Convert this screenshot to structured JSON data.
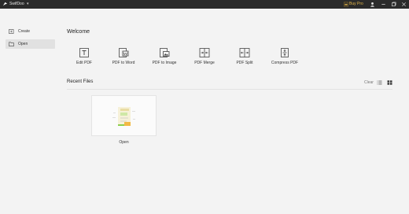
{
  "titlebar": {
    "app_name": "SwifDoo",
    "menu_arrow": "▾",
    "buy_pro": "Buy Pro",
    "icons": [
      "swifdoo-logo-icon",
      "crown-icon",
      "user-icon",
      "minimize-icon",
      "restore-icon",
      "close-icon"
    ]
  },
  "sidebar": {
    "items": [
      {
        "label": "Create",
        "icon": "create-icon",
        "active": false
      },
      {
        "label": "Open",
        "icon": "folder-icon",
        "active": true
      }
    ]
  },
  "main": {
    "welcome": "Welcome",
    "tools": [
      {
        "label": "Edit PDF",
        "icon": "edit-pdf-icon"
      },
      {
        "label": "PDF to Word",
        "icon": "pdf-to-word-icon"
      },
      {
        "label": "PDF to Image",
        "icon": "pdf-to-image-icon"
      },
      {
        "label": "PDF Merge",
        "icon": "pdf-merge-icon"
      },
      {
        "label": "PDF Split",
        "icon": "pdf-split-icon"
      },
      {
        "label": "Compress PDF",
        "icon": "compress-pdf-icon"
      }
    ],
    "recent": {
      "title": "Recent Files",
      "clear": "Clear",
      "view_modes": [
        "list",
        "grid"
      ],
      "files": [
        {
          "label": "Open"
        }
      ]
    }
  },
  "colors": {
    "titlebar": "#2b2b2b",
    "accent": "#e6b84a",
    "background": "#f3f3f3",
    "active_item": "#e1e1e1"
  }
}
